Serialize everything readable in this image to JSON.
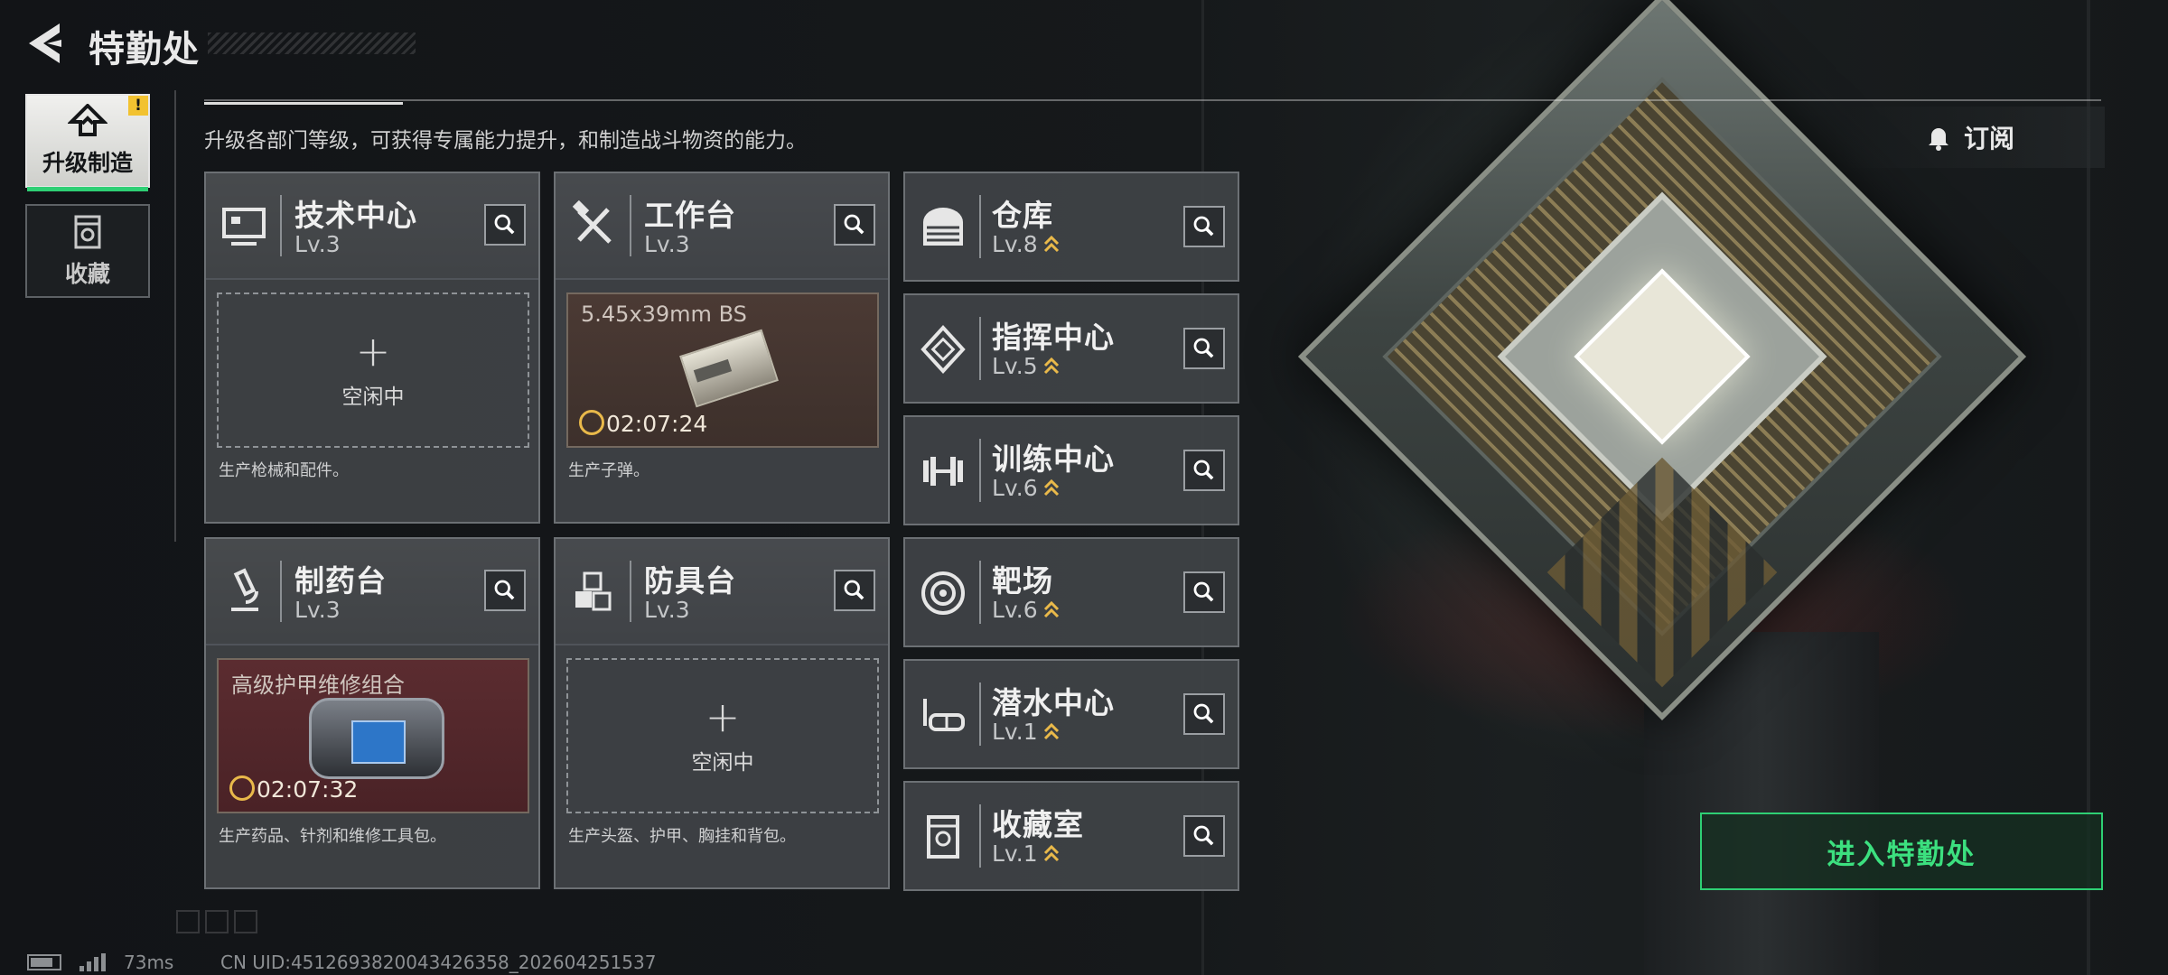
{
  "header": {
    "title": "特勤处",
    "subtitle": "升级各部门等级，可获得专属能力提升，和制造战斗物资的能力。",
    "back_icon": "back-arrow-icon"
  },
  "tabs": [
    {
      "label": "升级制造",
      "icon": "upgrade-build-icon",
      "active": true,
      "alert": "!"
    },
    {
      "label": "收藏",
      "icon": "collection-icon",
      "active": false
    }
  ],
  "workstations": [
    {
      "name": "技术中心",
      "level": "Lv.3",
      "icon": "monitor-icon",
      "slot": {
        "state": "idle",
        "plus": "+",
        "label": "空闲中"
      },
      "desc": "生产枪械和配件。"
    },
    {
      "name": "工作台",
      "level": "Lv.3",
      "icon": "hammer-wrench-icon",
      "slot": {
        "state": "producing",
        "item": "5.45x39mm BS",
        "timer": "02:07:24"
      },
      "desc": "生产子弹。"
    },
    {
      "name": "制药台",
      "level": "Lv.3",
      "icon": "microscope-icon",
      "slot": {
        "state": "producing",
        "item": "高级护甲维修组合",
        "timer": "02:07:32"
      },
      "desc": "生产药品、针剂和维修工具包。"
    },
    {
      "name": "防具台",
      "level": "Lv.3",
      "icon": "armor-blocks-icon",
      "slot": {
        "state": "idle",
        "plus": "+",
        "label": "空闲中"
      },
      "desc": "生产头盔、护甲、胸挂和背包。"
    }
  ],
  "facilities": [
    {
      "name": "仓库",
      "level": "Lv.8",
      "icon": "warehouse-icon"
    },
    {
      "name": "指挥中心",
      "level": "Lv.5",
      "icon": "command-icon"
    },
    {
      "name": "训练中心",
      "level": "Lv.6",
      "icon": "dumbbell-icon"
    },
    {
      "name": "靶场",
      "level": "Lv.6",
      "icon": "target-icon"
    },
    {
      "name": "潜水中心",
      "level": "Lv.1",
      "icon": "diving-mask-icon"
    },
    {
      "name": "收藏室",
      "level": "Lv.1",
      "icon": "collection-room-icon"
    }
  ],
  "subscribe": {
    "label": "订阅",
    "icon": "bell-icon"
  },
  "enter_button": {
    "label": "进入特勤处"
  },
  "status": {
    "ping": "73ms",
    "uid": "CN UID:4512693820043426358_202604251537"
  },
  "colors": {
    "accent": "#2ecf74",
    "warning": "#f2c230",
    "upgrade_chevron": "#e9b94a"
  }
}
